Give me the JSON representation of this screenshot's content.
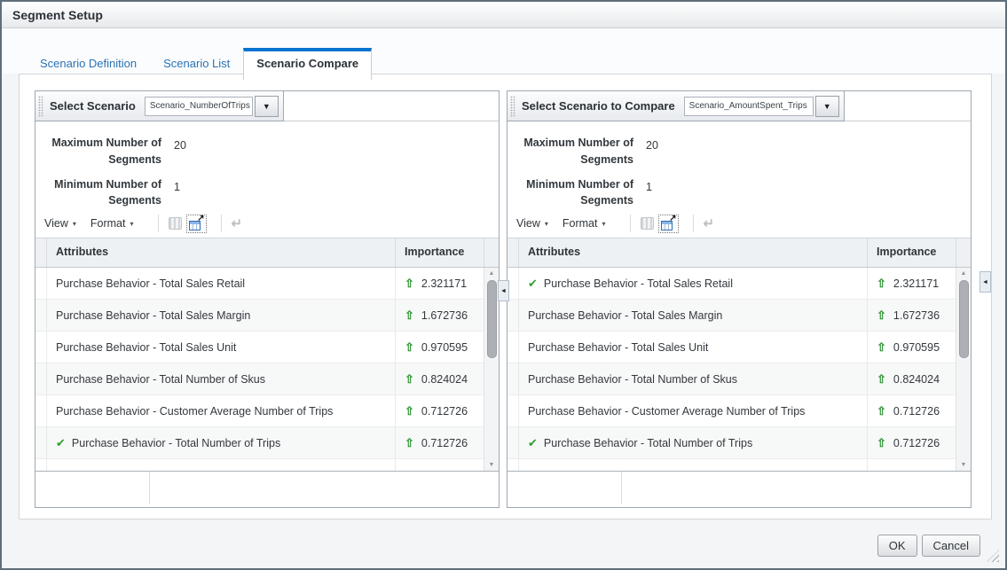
{
  "dialog": {
    "title": "Segment Setup",
    "ok_label": "OK",
    "cancel_label": "Cancel"
  },
  "tabs": [
    {
      "label": "Scenario Definition",
      "active": false
    },
    {
      "label": "Scenario List",
      "active": false
    },
    {
      "label": "Scenario Compare",
      "active": true
    }
  ],
  "panels": [
    {
      "selector": {
        "label": "Select Scenario",
        "value": "Scenario_NumberOfTrips"
      },
      "fields": [
        {
          "label": "Maximum Number of Segments",
          "value": "20"
        },
        {
          "label": "Minimum Number of Segments",
          "value": "1"
        }
      ],
      "toolbar": {
        "view": "View",
        "format": "Format"
      },
      "table": {
        "columns": {
          "attributes": "Attributes",
          "importance": "Importance"
        },
        "rows": [
          {
            "attribute": "Purchase Behavior - Total Sales Retail",
            "importance": "2.321171",
            "checked": false
          },
          {
            "attribute": "Purchase Behavior - Total Sales Margin",
            "importance": "1.672736",
            "checked": false
          },
          {
            "attribute": "Purchase Behavior - Total Sales Unit",
            "importance": "0.970595",
            "checked": false
          },
          {
            "attribute": "Purchase Behavior - Total Number of Skus",
            "importance": "0.824024",
            "checked": false
          },
          {
            "attribute": "Purchase Behavior - Customer Average Number of Trips",
            "importance": "0.712726",
            "checked": false
          },
          {
            "attribute": "Purchase Behavior - Total Number of Trips",
            "importance": "0.712726",
            "checked": true
          }
        ]
      }
    },
    {
      "selector": {
        "label": "Select Scenario to Compare",
        "value": "Scenario_AmountSpent_Trips"
      },
      "fields": [
        {
          "label": "Maximum Number of Segments",
          "value": "20"
        },
        {
          "label": "Minimum Number of Segments",
          "value": "1"
        }
      ],
      "toolbar": {
        "view": "View",
        "format": "Format"
      },
      "table": {
        "columns": {
          "attributes": "Attributes",
          "importance": "Importance"
        },
        "rows": [
          {
            "attribute": "Purchase Behavior - Total Sales Retail",
            "importance": "2.321171",
            "checked": true
          },
          {
            "attribute": "Purchase Behavior - Total Sales Margin",
            "importance": "1.672736",
            "checked": false
          },
          {
            "attribute": "Purchase Behavior - Total Sales Unit",
            "importance": "0.970595",
            "checked": false
          },
          {
            "attribute": "Purchase Behavior - Total Number of Skus",
            "importance": "0.824024",
            "checked": false
          },
          {
            "attribute": "Purchase Behavior - Customer Average Number of Trips",
            "importance": "0.712726",
            "checked": false
          },
          {
            "attribute": "Purchase Behavior - Total Number of Trips",
            "importance": "0.712726",
            "checked": true
          }
        ]
      }
    }
  ],
  "icons": {
    "dropdown_arrow": "▼",
    "menu_caret": "▾",
    "check_mark": "✔",
    "up_arrow": "⇧",
    "scroll_up_arrow": "▲",
    "scroll_down_arrow": "▼",
    "collapse_arrow": "◄",
    "detach_arrow": "↗",
    "wrap_arrow": "↵"
  }
}
